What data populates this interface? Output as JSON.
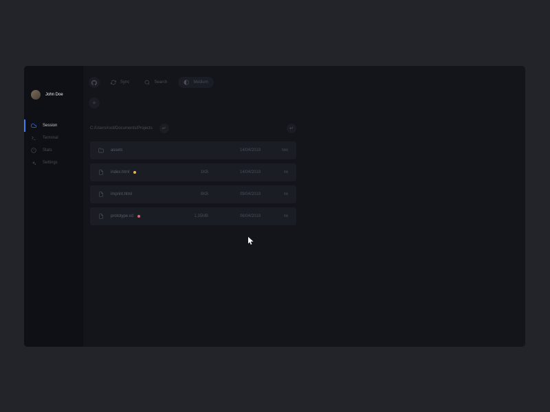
{
  "user": {
    "name": "John Doe"
  },
  "sidebar": {
    "items": [
      {
        "label": "Session"
      },
      {
        "label": "Terminal"
      },
      {
        "label": "Stats"
      },
      {
        "label": "Settings"
      }
    ]
  },
  "topbar": {
    "github": "",
    "sync": "Sync",
    "search": "Search",
    "medium": "Medium"
  },
  "path": {
    "value": "C:/Users/root/Documents/Projects"
  },
  "files": [
    {
      "name": "assets",
      "type": "folder",
      "size": "",
      "date": "14/04/2019",
      "perm": "rwx",
      "tag": ""
    },
    {
      "name": "index.html",
      "type": "file",
      "size": "1KB",
      "date": "14/04/2019",
      "perm": "rw",
      "tag": "yellow"
    },
    {
      "name": "imprint.html",
      "type": "file",
      "size": "8KB",
      "date": "09/04/2019",
      "perm": "rw",
      "tag": ""
    },
    {
      "name": "prototype.xd",
      "type": "file",
      "size": "1,35MB",
      "date": "06/04/2019",
      "perm": "rw",
      "tag": "pink"
    }
  ]
}
